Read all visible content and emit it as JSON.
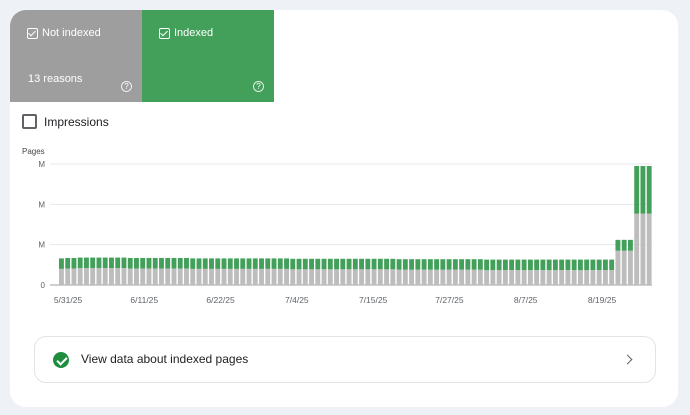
{
  "tiles": {
    "not_indexed": {
      "label": "Not indexed",
      "reasons": "13 reasons",
      "help": "?",
      "color": "#9e9e9e"
    },
    "indexed": {
      "label": "Indexed",
      "help": "?",
      "color": "#43a05a"
    }
  },
  "impressions": {
    "label": "Impressions",
    "checked": false
  },
  "cta": {
    "label": "View data about indexed pages"
  },
  "chart_data": {
    "type": "bar",
    "stacked": true,
    "ylabel": "Pages",
    "y_tick_labels": [
      "0",
      "M",
      "M",
      "M"
    ],
    "x_tick_labels": [
      "5/31/25",
      "6/11/25",
      "6/22/25",
      "7/4/25",
      "7/15/25",
      "7/27/25",
      "8/7/25",
      "8/19/25"
    ],
    "ylim": [
      0,
      3
    ],
    "grid": true,
    "colors": {
      "not_indexed": "#bdbdbd",
      "indexed": "#43a05a"
    },
    "series": [
      {
        "key": "not_indexed",
        "values": [
          0.4,
          0.41,
          0.41,
          0.42,
          0.42,
          0.42,
          0.42,
          0.42,
          0.42,
          0.42,
          0.42,
          0.41,
          0.41,
          0.41,
          0.41,
          0.41,
          0.41,
          0.41,
          0.41,
          0.41,
          0.41,
          0.4,
          0.4,
          0.4,
          0.4,
          0.4,
          0.4,
          0.4,
          0.4,
          0.4,
          0.4,
          0.4,
          0.4,
          0.4,
          0.4,
          0.4,
          0.4,
          0.39,
          0.39,
          0.39,
          0.39,
          0.39,
          0.39,
          0.39,
          0.39,
          0.39,
          0.39,
          0.39,
          0.39,
          0.39,
          0.39,
          0.39,
          0.39,
          0.39,
          0.38,
          0.38,
          0.38,
          0.38,
          0.38,
          0.38,
          0.38,
          0.38,
          0.38,
          0.38,
          0.38,
          0.38,
          0.38,
          0.38,
          0.37,
          0.37,
          0.37,
          0.37,
          0.37,
          0.37,
          0.37,
          0.37,
          0.37,
          0.37,
          0.37,
          0.37,
          0.37,
          0.37,
          0.37,
          0.37,
          0.37,
          0.37,
          0.37,
          0.37,
          0.37,
          0.85,
          0.85,
          0.85,
          1.77,
          1.77,
          1.77
        ]
      },
      {
        "key": "indexed",
        "values": [
          0.26,
          0.26,
          0.26,
          0.26,
          0.26,
          0.26,
          0.26,
          0.26,
          0.26,
          0.26,
          0.26,
          0.26,
          0.26,
          0.26,
          0.26,
          0.26,
          0.26,
          0.26,
          0.26,
          0.26,
          0.26,
          0.26,
          0.26,
          0.26,
          0.26,
          0.26,
          0.26,
          0.26,
          0.26,
          0.26,
          0.26,
          0.26,
          0.26,
          0.26,
          0.26,
          0.26,
          0.26,
          0.26,
          0.26,
          0.26,
          0.26,
          0.26,
          0.26,
          0.26,
          0.26,
          0.26,
          0.26,
          0.26,
          0.26,
          0.26,
          0.26,
          0.26,
          0.26,
          0.26,
          0.26,
          0.26,
          0.26,
          0.26,
          0.26,
          0.26,
          0.26,
          0.26,
          0.26,
          0.26,
          0.26,
          0.26,
          0.26,
          0.26,
          0.26,
          0.26,
          0.26,
          0.26,
          0.26,
          0.26,
          0.26,
          0.26,
          0.26,
          0.26,
          0.26,
          0.26,
          0.26,
          0.26,
          0.26,
          0.26,
          0.26,
          0.26,
          0.26,
          0.26,
          0.26,
          0.27,
          0.27,
          0.27,
          1.18,
          1.18,
          1.18
        ]
      }
    ]
  }
}
